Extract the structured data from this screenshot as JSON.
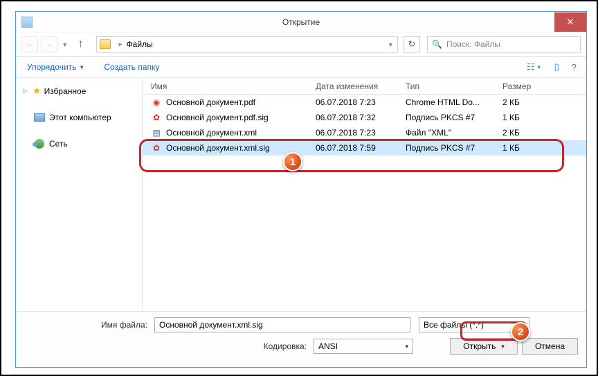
{
  "title": "Открытие",
  "breadcrumb": {
    "location": "Файлы"
  },
  "search": {
    "placeholder": "Поиск: Файлы"
  },
  "toolbar": {
    "organize": "Упорядочить",
    "newfolder": "Создать папку"
  },
  "nav": {
    "favorites": "Избранное",
    "computer": "Этот компьютер",
    "network": "Сеть"
  },
  "columns": {
    "name": "Имя",
    "modified": "Дата изменения",
    "type": "Тип",
    "size": "Размер"
  },
  "files": [
    {
      "name": "Основной документ.pdf",
      "modified": "06.07.2018 7:23",
      "type": "Chrome HTML Do...",
      "size": "2 КБ",
      "icon": "pdf"
    },
    {
      "name": "Основной документ.pdf.sig",
      "modified": "06.07.2018 7:32",
      "type": "Подпись PKCS #7",
      "size": "1 КБ",
      "icon": "sig"
    },
    {
      "name": "Основной документ.xml",
      "modified": "06.07.2018 7:23",
      "type": "Файл \"XML\"",
      "size": "2 КБ",
      "icon": "xml"
    },
    {
      "name": "Основной документ.xml.sig",
      "modified": "06.07.2018 7:59",
      "type": "Подпись PKCS #7",
      "size": "1 КБ",
      "icon": "sig",
      "selected": true
    }
  ],
  "footer": {
    "filename_label": "Имя файла:",
    "filename_value": "Основной документ.xml.sig",
    "filter": "Все файлы (*.*)",
    "encoding_label": "Кодировка:",
    "encoding_value": "ANSI",
    "open": "Открыть",
    "cancel": "Отмена"
  },
  "badges": {
    "one": "1",
    "two": "2"
  }
}
